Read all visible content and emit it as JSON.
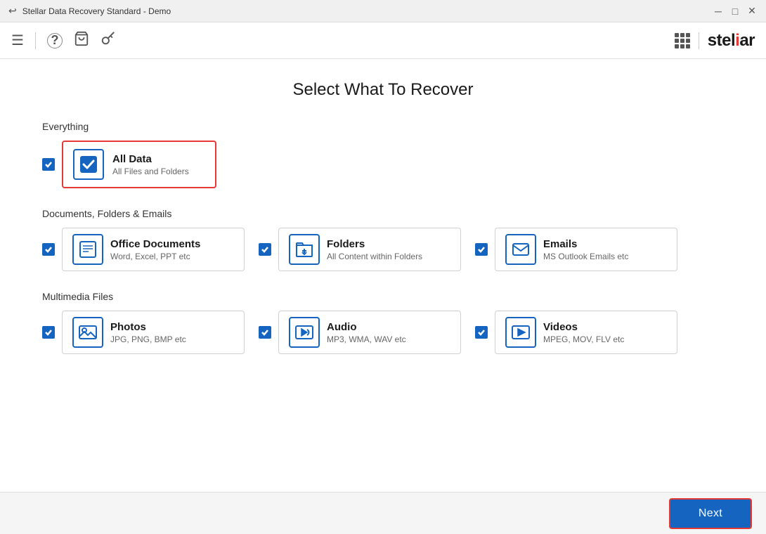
{
  "window": {
    "title": "Stellar Data Recovery Standard - Demo"
  },
  "toolbar": {
    "menu_icon": "☰",
    "help_icon": "?",
    "cart_icon": "🛒",
    "key_icon": "🔑"
  },
  "stellar_logo": {
    "text_before": "stel",
    "highlight": "i",
    "text_after": "ar"
  },
  "page": {
    "title": "Select What To Recover"
  },
  "sections": {
    "everything": {
      "label": "Everything",
      "item": {
        "title": "All Data",
        "subtitle": "All Files and Folders",
        "checked": true,
        "selected": true
      }
    },
    "documents": {
      "label": "Documents, Folders & Emails",
      "items": [
        {
          "title": "Office Documents",
          "subtitle": "Word, Excel, PPT etc",
          "checked": true
        },
        {
          "title": "Folders",
          "subtitle": "All Content within Folders",
          "checked": true
        },
        {
          "title": "Emails",
          "subtitle": "MS Outlook Emails etc",
          "checked": true
        }
      ]
    },
    "multimedia": {
      "label": "Multimedia Files",
      "items": [
        {
          "title": "Photos",
          "subtitle": "JPG, PNG, BMP etc",
          "checked": true
        },
        {
          "title": "Audio",
          "subtitle": "MP3, WMA, WAV etc",
          "checked": true
        },
        {
          "title": "Videos",
          "subtitle": "MPEG, MOV, FLV etc",
          "checked": true
        }
      ]
    }
  },
  "footer": {
    "next_button": "Next"
  }
}
